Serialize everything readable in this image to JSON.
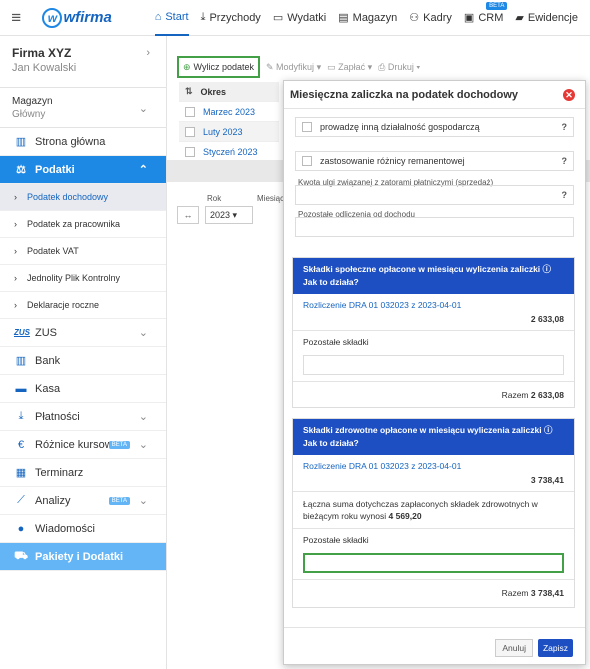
{
  "topbar": {
    "logo": "wfirma",
    "nav": [
      {
        "label": "Start",
        "icon": "home-icon",
        "glyph": "⌂"
      },
      {
        "label": "Przychody",
        "icon": "income-icon",
        "glyph": "⤓"
      },
      {
        "label": "Wydatki",
        "icon": "expenses-icon",
        "glyph": "▭"
      },
      {
        "label": "Magazyn",
        "icon": "warehouse-icon",
        "glyph": "▤"
      },
      {
        "label": "Kadry",
        "icon": "people-icon",
        "glyph": "⚇"
      },
      {
        "label": "CRM",
        "icon": "crm-icon",
        "glyph": "▣",
        "badge": "BETA"
      },
      {
        "label": "Ewidencje",
        "icon": "folder-icon",
        "glyph": "▰"
      }
    ]
  },
  "sidebar": {
    "company_name": "Firma XYZ",
    "user_name": "Jan Kowalski",
    "warehouse_label": "Magazyn",
    "warehouse_value": "Główny",
    "items": [
      {
        "label": "Strona główna",
        "icon": "home-icon",
        "glyph": "▥"
      },
      {
        "label": "Podatki",
        "icon": "scales-icon",
        "glyph": "⚖"
      },
      {
        "label": "Podatek dochodowy"
      },
      {
        "label": "Podatek za pracownika"
      },
      {
        "label": "Podatek VAT"
      },
      {
        "label": "Jednolity Plik Kontrolny"
      },
      {
        "label": "Deklaracje roczne"
      },
      {
        "label": "ZUS",
        "icon": "zus-icon",
        "glyph": "ZUS"
      },
      {
        "label": "Bank",
        "icon": "bank-icon",
        "glyph": "▥"
      },
      {
        "label": "Kasa",
        "icon": "cash-icon",
        "glyph": "▬"
      },
      {
        "label": "Płatności",
        "icon": "payments-icon",
        "glyph": "⤓"
      },
      {
        "label": "Różnice kursowe",
        "icon": "euro-icon",
        "glyph": "€",
        "badge": "BETA"
      },
      {
        "label": "Terminarz",
        "icon": "calendar-icon",
        "glyph": "▦"
      },
      {
        "label": "Analizy",
        "icon": "chart-icon",
        "glyph": "⟋",
        "badge": "BETA"
      },
      {
        "label": "Wiadomości",
        "icon": "chat-icon",
        "glyph": "●"
      },
      {
        "label": "Pakiety i Dodatki",
        "icon": "cart-icon",
        "glyph": "⛟"
      }
    ]
  },
  "toolbar": {
    "calc": "Wylicz podatek",
    "modify": "Modyfikuj",
    "pay": "Zapłać",
    "print": "Drukuj"
  },
  "table": {
    "header": "Okres",
    "rows": [
      "Marzec 2023",
      "Luty 2023",
      "Styczeń 2023"
    ]
  },
  "filters": {
    "year_label": "Rok",
    "year_value": "2023",
    "month_label": "Miesiąc"
  },
  "modal": {
    "title": "Miesięczna zaliczka na podatek dochodowy",
    "opt1": "prowadzę inną działalność gospodarczą",
    "opt2": "zastosowanie różnicy remanentowej",
    "relief_label": "Kwota ulgi związanej z zatorami płatniczymi (sprzedaż)",
    "other_label": "Pozostałe odliczenia od dochodu",
    "help": "?",
    "social": {
      "head": "Składki społeczne opłacone w miesiącu wyliczenia zaliczki",
      "howto": "Jak to działa?",
      "link": "Rozliczenie DRA 01 032023 z 2023-04-01",
      "amount": "2 633,08",
      "other_label": "Pozostałe składki",
      "sum_label": "Razem",
      "sum": "2 633,08"
    },
    "health": {
      "head": "Składki zdrowotne opłacone w miesiącu wyliczenia zaliczki",
      "howto": "Jak to działa?",
      "link": "Rozliczenie DRA 01 032023 z 2023-04-01",
      "amount": "3 738,41",
      "total_text": "Łączna suma dotychczas zapłaconych składek zdrowotnych w bieżącym roku wynosi",
      "total_value": "4 569,20",
      "other_label": "Pozostałe składki",
      "sum_label": "Razem",
      "sum": "3 738,41"
    },
    "cancel": "Anuluj",
    "save": "Zapisz"
  }
}
